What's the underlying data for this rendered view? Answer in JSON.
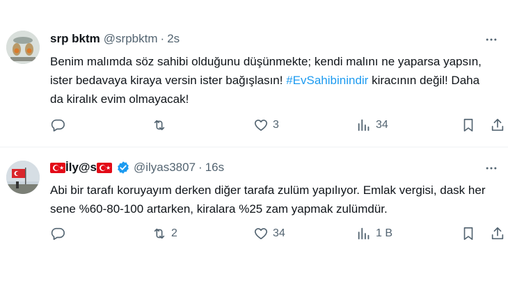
{
  "tweets": [
    {
      "display_name": "srp bktm",
      "handle": "@srpbktm",
      "separator": "·",
      "time": "2s",
      "text_before": "Benim malımda söz sahibi olduğunu düşünmekte; kendi malını ne yaparsa yapsın, ister bedavaya kiraya versin ister bağışlasın! ",
      "hashtag": "#EvSahibinindir",
      "text_after": " kiracının değil! Daha da kiralık evim olmayacak!",
      "reply_count": "",
      "repost_count": "",
      "like_count": "3",
      "view_count": "34"
    },
    {
      "display_name_parts": [
        "İly@s"
      ],
      "handle": "@ilyas3807",
      "separator": "·",
      "time": "16s",
      "text": "Abi bir tarafı koruyayım derken diğer tarafa zulüm yapılıyor. Emlak vergisi, dask her sene %60-80-100 artarken, kiralara %25 zam yapmak zulümdür.",
      "reply_count": "",
      "repost_count": "2",
      "like_count": "34",
      "view_count": "1 B"
    }
  ],
  "colors": {
    "text": "#0f1419",
    "secondary": "#536471",
    "link": "#1d9bf0",
    "divider": "#eff3f4"
  },
  "icons": [
    "reply-icon",
    "repost-icon",
    "like-icon",
    "views-icon",
    "bookmark-icon",
    "share-icon",
    "more-icon",
    "verified-icon"
  ]
}
